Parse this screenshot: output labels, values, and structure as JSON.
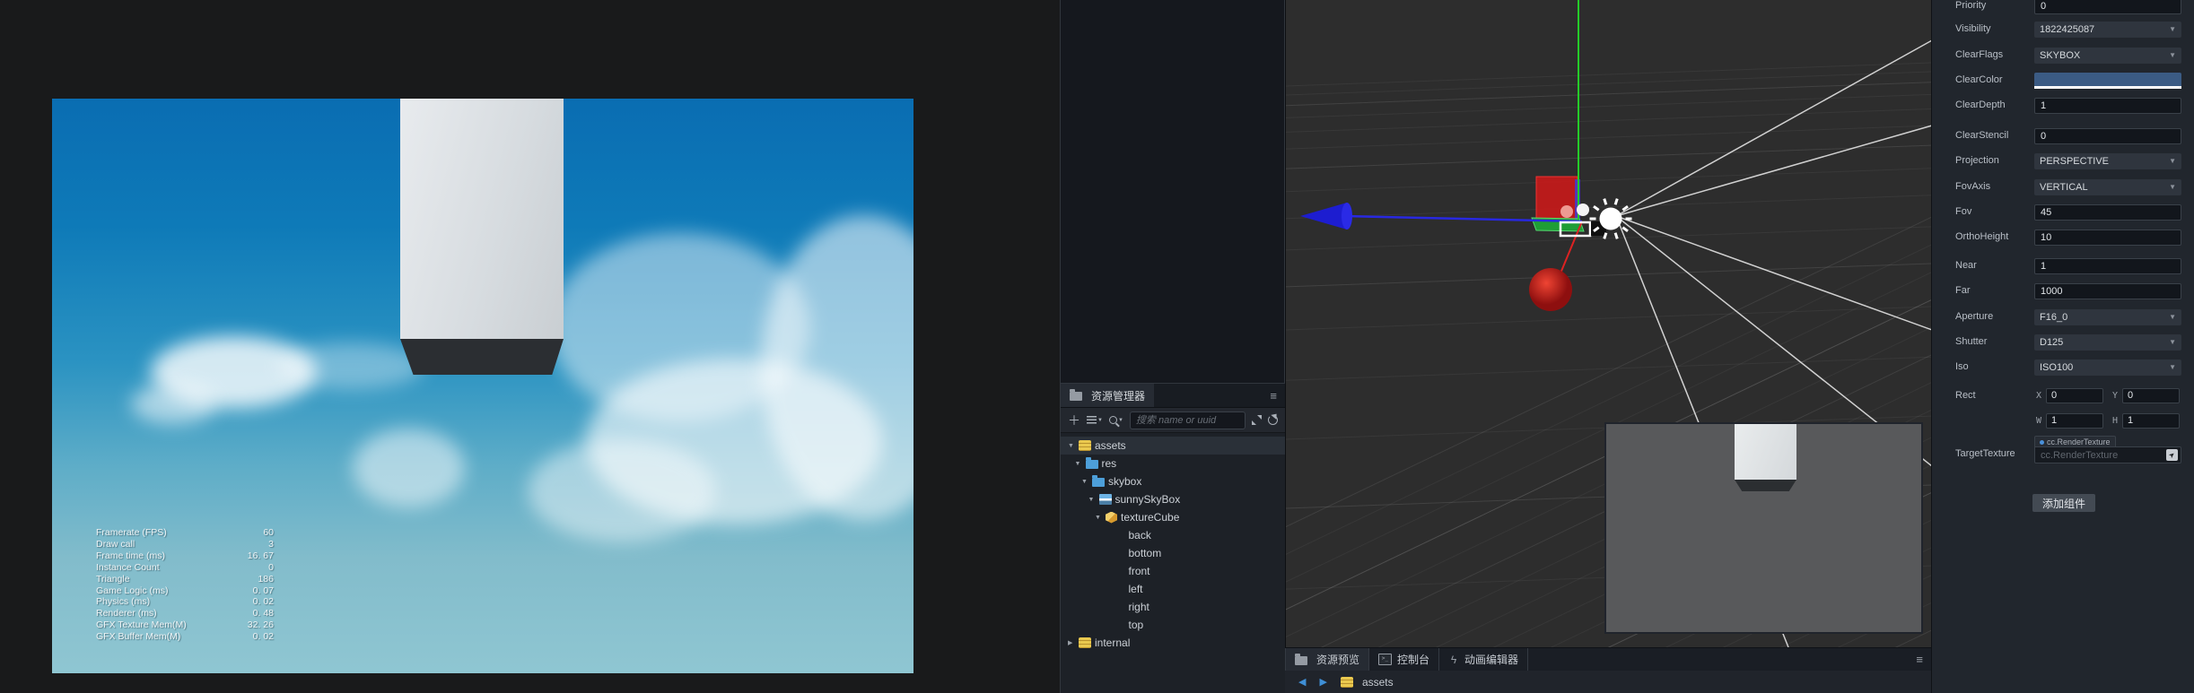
{
  "game_view": {
    "stats": [
      {
        "label": "Framerate (FPS)",
        "value": "60"
      },
      {
        "label": "Draw call",
        "value": "3"
      },
      {
        "label": "Frame time (ms)",
        "value": "16. 67"
      },
      {
        "label": "Instance Count",
        "value": "0"
      },
      {
        "label": "Triangle",
        "value": "186"
      },
      {
        "label": "Game Logic (ms)",
        "value": "0. 07"
      },
      {
        "label": "Physics (ms)",
        "value": "0. 02"
      },
      {
        "label": "Renderer (ms)",
        "value": "0. 48"
      },
      {
        "label": "GFX Texture Mem(M)",
        "value": "32. 26"
      },
      {
        "label": "GFX Buffer Mem(M)",
        "value": "0. 02"
      }
    ]
  },
  "assets_panel": {
    "tab_label": "资源管理器",
    "menu_glyph": "≡",
    "search_placeholder": "搜索 name or uuid",
    "tree": [
      {
        "label": "assets",
        "icon": "database",
        "level": 0,
        "arrow": "down",
        "selected": true
      },
      {
        "label": "res",
        "icon": "folder",
        "level": 1,
        "arrow": "down",
        "selected": false
      },
      {
        "label": "skybox",
        "icon": "folder",
        "level": 2,
        "arrow": "down",
        "selected": false
      },
      {
        "label": "sunnySkyBox",
        "icon": "image",
        "level": 3,
        "arrow": "down",
        "selected": false
      },
      {
        "label": "textureCube",
        "icon": "cube",
        "level": 4,
        "arrow": "down",
        "selected": false
      },
      {
        "label": "back",
        "icon": "none",
        "level": 5,
        "arrow": "none",
        "selected": false
      },
      {
        "label": "bottom",
        "icon": "none",
        "level": 5,
        "arrow": "none",
        "selected": false
      },
      {
        "label": "front",
        "icon": "none",
        "level": 5,
        "arrow": "none",
        "selected": false
      },
      {
        "label": "left",
        "icon": "none",
        "level": 5,
        "arrow": "none",
        "selected": false
      },
      {
        "label": "right",
        "icon": "none",
        "level": 5,
        "arrow": "none",
        "selected": false
      },
      {
        "label": "top",
        "icon": "none",
        "level": 5,
        "arrow": "none",
        "selected": false
      },
      {
        "label": "internal",
        "icon": "database",
        "level": 0,
        "arrow": "right",
        "selected": false
      }
    ]
  },
  "bottom_bar": {
    "tabs": [
      {
        "label": "资源预览",
        "icon": "folder",
        "active": true
      },
      {
        "label": "控制台",
        "icon": "terminal",
        "active": false
      },
      {
        "label": "动画编辑器",
        "icon": "animation",
        "active": false
      }
    ],
    "menu_glyph": "≡",
    "breadcrumb_back": "◀",
    "breadcrumb_forward": "▶",
    "breadcrumb_label": "assets"
  },
  "inspector": {
    "rows": [
      {
        "label": "Priority",
        "type": "input",
        "value": "0"
      },
      {
        "label": "Visibility",
        "type": "select",
        "value": "1822425087"
      },
      {
        "label": "ClearFlags",
        "type": "select",
        "value": "SKYBOX"
      },
      {
        "label": "ClearColor",
        "type": "color",
        "value": "#3b5b84"
      },
      {
        "label": "ClearDepth",
        "type": "input",
        "value": "1"
      },
      {
        "label": "ClearStencil",
        "type": "input",
        "value": "0"
      },
      {
        "label": "Projection",
        "type": "select",
        "value": "PERSPECTIVE"
      },
      {
        "label": "FovAxis",
        "type": "select",
        "value": "VERTICAL"
      },
      {
        "label": "Fov",
        "type": "input",
        "value": "45"
      },
      {
        "label": "OrthoHeight",
        "type": "input",
        "value": "10"
      },
      {
        "label": "Near",
        "type": "input",
        "value": "1"
      },
      {
        "label": "Far",
        "type": "input",
        "value": "1000"
      },
      {
        "label": "Aperture",
        "type": "select",
        "value": "F16_0"
      },
      {
        "label": "Shutter",
        "type": "select",
        "value": "D125"
      },
      {
        "label": "Iso",
        "type": "select",
        "value": "ISO100"
      },
      {
        "label": "Rect",
        "type": "rect",
        "fields": [
          {
            "k": "X",
            "v": "0"
          },
          {
            "k": "Y",
            "v": "0"
          },
          {
            "k": "W",
            "v": "1"
          },
          {
            "k": "H",
            "v": "1"
          }
        ]
      },
      {
        "label": "TargetTexture",
        "type": "asset",
        "tag": "cc.RenderTexture",
        "placeholder": "cc.RenderTexture"
      }
    ],
    "add_component_label": "添加组件"
  },
  "colors": {
    "axis_green": "#25cc28",
    "axis_blue": "#2828e0",
    "axis_red": "#dd2222",
    "clear_color_swatch": "#3b5b84",
    "nav_blue": "#3f8fd6",
    "scene_bg": "#2d2d2d"
  }
}
